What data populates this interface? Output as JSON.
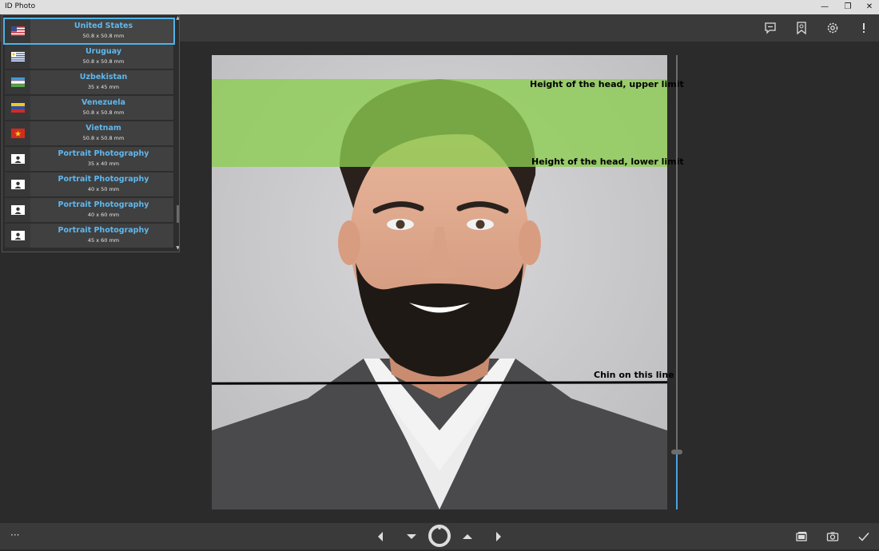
{
  "app": {
    "title": "ID Photo"
  },
  "window_controls": {
    "minimize": "—",
    "restore": "❐",
    "close": "✕"
  },
  "toolbar": {
    "icons": [
      "feedback-icon",
      "bookmark-icon",
      "settings-icon",
      "info-icon"
    ]
  },
  "guides": {
    "upper_label": "Height of the head, upper limit",
    "lower_label": "Height of the head, lower limit",
    "chin_label": "Chin on this line",
    "band_color": "#8ccd50"
  },
  "countries": [
    {
      "name": "United States",
      "size": "50.8 x 50.8 mm",
      "flag": "us-flag-icon",
      "selected": true
    },
    {
      "name": "Uruguay",
      "size": "50.8 x 50.8 mm",
      "flag": "uruguay-flag-icon"
    },
    {
      "name": "Uzbekistan",
      "size": "35 x 45 mm",
      "flag": "uzbekistan-flag-icon"
    },
    {
      "name": "Venezuela",
      "size": "50.8 x 50.8 mm",
      "flag": "venezuela-flag-icon"
    },
    {
      "name": "Vietnam",
      "size": "50.8 x 50.8 mm",
      "flag": "vietnam-flag-icon"
    },
    {
      "name": "Portrait Photography",
      "size": "35 x 40 mm",
      "flag": "portrait-icon"
    },
    {
      "name": "Portrait Photography",
      "size": "40 x 50 mm",
      "flag": "portrait-icon"
    },
    {
      "name": "Portrait Photography",
      "size": "40 x 60 mm",
      "flag": "portrait-icon"
    },
    {
      "name": "Portrait Photography",
      "size": "45 x 60 mm",
      "flag": "portrait-icon"
    }
  ],
  "bottombar": {
    "more": "···",
    "icons": [
      "prev-icon",
      "down-icon",
      "spinner-icon",
      "up-icon",
      "next-icon",
      "gallery-icon",
      "camera-icon",
      "checkmark-icon"
    ]
  },
  "colors": {
    "accent": "#4fb3e8",
    "list_text": "#5fb8ee",
    "background": "#2b2b2b",
    "bar": "#3a3a3a"
  }
}
